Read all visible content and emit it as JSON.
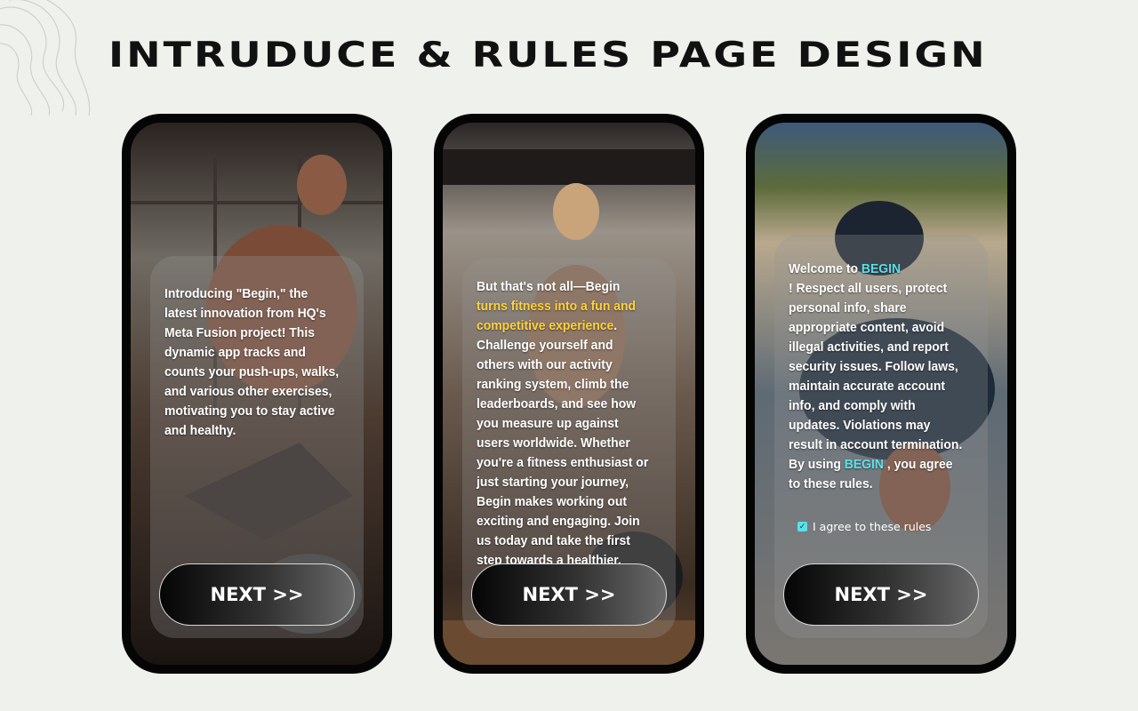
{
  "title": "INTRUDUCE & RULES PAGE DESIGN",
  "screens": [
    {
      "segments": [
        "Introducing \"Begin,\" the latest innovation from HQ's Meta Fusion project! This dynamic app tracks and counts your push-ups, walks, and various other exercises, motivating you to stay active and healthy."
      ],
      "button_label": "NEXT >>"
    },
    {
      "segments": [
        "But that's not all—Begin ",
        "turns fitness into a fun and competitive experience",
        ". Challenge yourself and others with our activity ranking system, climb the leaderboards, and see how you measure up against users worldwide. Whether you're a fitness enthusiast or just starting your journey, Begin makes working out exciting and engaging. Join us today and take the first step towards a healthier, more active lifestyle!"
      ],
      "button_label": "NEXT >>"
    },
    {
      "segments": [
        "Welcome to ",
        "BEGIN",
        "! Respect all users, protect personal info, share appropriate content, avoid illegal activities, and report security issues. Follow laws, maintain accurate account info, and comply with updates. Violations may result in account termination. By using ",
        "BEGIN",
        " , you agree to these rules."
      ],
      "agree_label": "I  agree to these rules",
      "agree_checked": true,
      "button_label": "NEXT >>"
    }
  ],
  "colors": {
    "accent_yellow": "#ffd23a",
    "accent_cyan": "#5ae0ea",
    "page_background": "#eff1ec"
  },
  "icons": [
    "contour-lines-decoration",
    "check-icon"
  ]
}
